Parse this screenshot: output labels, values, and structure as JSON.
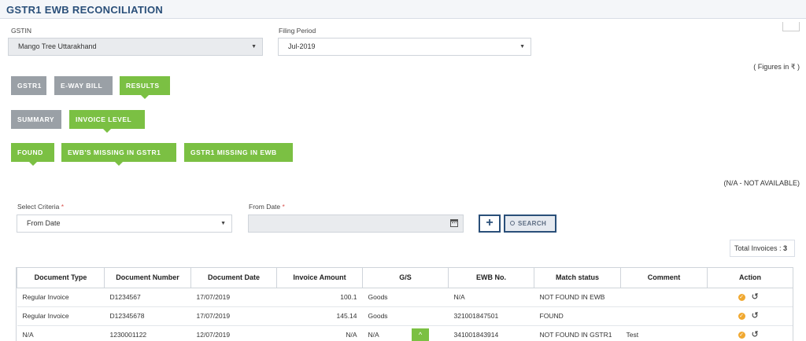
{
  "header": {
    "title": "GSTR1 EWB RECONCILIATION"
  },
  "filters": {
    "gstin_label": "GSTIN",
    "gstin_value": "Mango Tree Uttarakhand",
    "period_label": "Filing Period",
    "period_value": "Jul-2019"
  },
  "figures_note": "( Figures in ₹ )",
  "tabs_level1": [
    {
      "label": "GSTR1",
      "state": "inactive"
    },
    {
      "label": "E-WAY BILL",
      "state": "inactive"
    },
    {
      "label": "RESULTS",
      "state": "active"
    }
  ],
  "tabs_level2": [
    {
      "label": "SUMMARY",
      "state": "inactive"
    },
    {
      "label": "INVOICE LEVEL",
      "state": "active"
    }
  ],
  "tabs_level3": [
    {
      "label": "FOUND",
      "state": "active"
    },
    {
      "label": "EWB'S MISSING IN GSTR1",
      "state": "active"
    },
    {
      "label": "GSTR1 MISSING IN EWB",
      "state": "active"
    }
  ],
  "na_note": "(N/A - NOT AVAILABLE)",
  "criteria": {
    "select_label": "Select Criteria",
    "select_value": "From Date",
    "date_label": "From Date",
    "required_mark": "*",
    "plus_label": "+",
    "search_label": "SEARCH"
  },
  "totals": {
    "label": "Total Invoices :",
    "value": "3"
  },
  "table": {
    "headers": [
      "Document Type",
      "Document Number",
      "Document Date",
      "Invoice Amount",
      "G/S",
      "EWB No.",
      "Match status",
      "Comment",
      "Action"
    ],
    "rows": [
      {
        "doc_type": "Regular Invoice",
        "doc_number": "D1234567",
        "doc_date": "17/07/2019",
        "amount": "100.1",
        "gs": "Goods",
        "ewb": "N/A",
        "status": "NOT FOUND IN EWB",
        "comment": ""
      },
      {
        "doc_type": "Regular Invoice",
        "doc_number": "D12345678",
        "doc_date": "17/07/2019",
        "amount": "145.14",
        "gs": "Goods",
        "ewb": "321001847501",
        "status": "FOUND",
        "comment": ""
      },
      {
        "doc_type": "N/A",
        "doc_number": "1230001122",
        "doc_date": "12/07/2019",
        "amount": "N/A",
        "gs": "N/A",
        "ewb": "341001843914",
        "status": "NOT FOUND IN GSTR1",
        "comment": "Test"
      }
    ]
  },
  "icons": {
    "select_caret": "caret-down-icon",
    "calendar": "calendar-icon",
    "search": "magnifier-icon",
    "action_ok": "check-circle-icon",
    "action_reset": "undo-icon",
    "scroll_top": "chevron-up-icon"
  },
  "colors": {
    "brand": "#2a4f79",
    "active_tab": "#7bc043",
    "inactive_tab": "#9aa0a6",
    "ok_icon": "#f0a830"
  }
}
